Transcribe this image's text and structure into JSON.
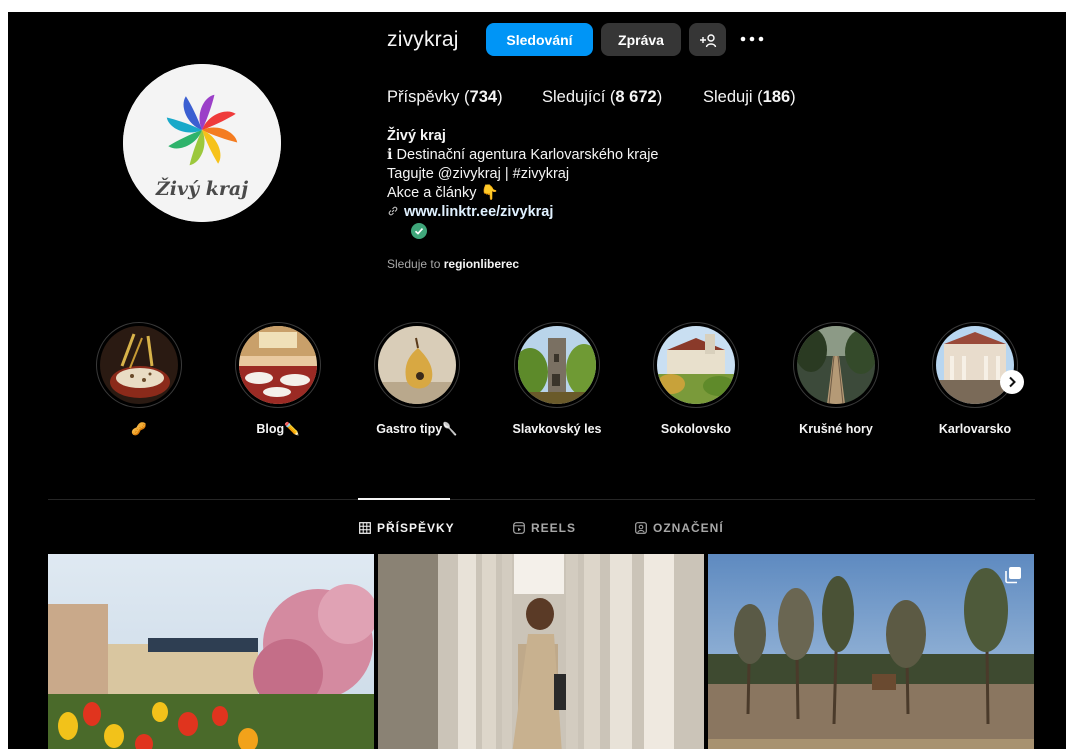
{
  "profile": {
    "username": "zivykraj",
    "avatar_text": "Živý kraj",
    "follow_button": "Sledování",
    "message_button": "Zpráva",
    "suggest_icon": "person-add-icon",
    "more_icon": "more-dots-icon"
  },
  "stats": {
    "posts_label": "Příspěvky",
    "posts_value": "734",
    "followers_label": "Sledující",
    "followers_value": "8 672",
    "following_label": "Sleduji",
    "following_value": "186"
  },
  "bio": {
    "full_name": "Živý kraj",
    "line1": "ℹ Destinační agentura Karlovarského kraje",
    "line2": "Tagujte @zivykraj | #zivykraj",
    "line3": "Akce a články 👇",
    "link": "www.linktr.ee/zivykraj",
    "link_icon": "link-icon",
    "verified_icon": "check-circle-icon"
  },
  "followed_by": {
    "prefix": "Sleduje to",
    "account": "regionliberec"
  },
  "highlights": [
    {
      "label": "🥜",
      "icon": "wheat-beer-image"
    },
    {
      "label": "Blog✏️",
      "icon": "restaurant-image"
    },
    {
      "label": "Gastro tipy🥄",
      "icon": "pear-dessert-image"
    },
    {
      "label": "Slavkovský les",
      "icon": "stone-tower-image"
    },
    {
      "label": "Sokolovsko",
      "icon": "castle-image"
    },
    {
      "label": "Krušné hory",
      "icon": "boardwalk-image"
    },
    {
      "label": "Karlovarsko",
      "icon": "colonnade-image"
    }
  ],
  "highlights_next_icon": "chevron-right-icon",
  "tabs": [
    {
      "label": "PŘÍSPĚVKY",
      "icon": "grid-icon",
      "active": true
    },
    {
      "label": "REELS",
      "icon": "reels-icon",
      "active": false
    },
    {
      "label": "OZNAČENÍ",
      "icon": "tagged-icon",
      "active": false
    }
  ],
  "posts": [
    {
      "icon": "spa-garden-photo"
    },
    {
      "icon": "colonnade-woman-photo"
    },
    {
      "icon": "forest-photo",
      "multi": true
    }
  ],
  "colors": {
    "background": "#000000",
    "accent": "#0095f6",
    "button_secondary": "#363636",
    "muted_text": "#a8a8a8"
  }
}
